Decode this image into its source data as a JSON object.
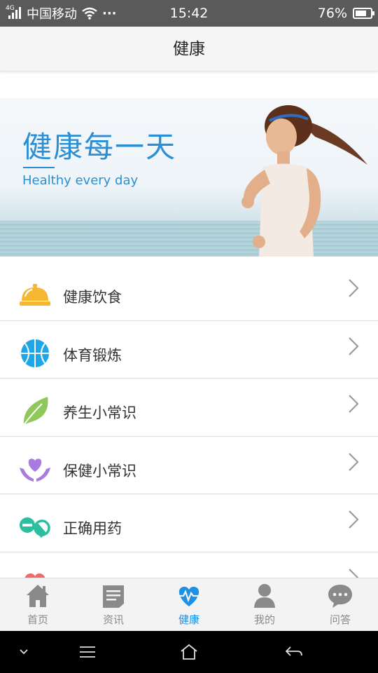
{
  "status_bar": {
    "network": "4G",
    "carrier": "中国移动",
    "more": "···",
    "time": "15:42",
    "battery_text": "76%",
    "battery_level": 0.76
  },
  "header": {
    "title": "健康"
  },
  "banner": {
    "title": "健康每一天",
    "subtitle": "Healthy every day"
  },
  "list": {
    "items": [
      {
        "label": "健康饮食",
        "icon": "food-cloche-icon",
        "color": "#f5b731"
      },
      {
        "label": "体育锻炼",
        "icon": "basketball-icon",
        "color": "#1ea6e8"
      },
      {
        "label": "养生小常识",
        "icon": "leaf-icon",
        "color": "#8fc85a"
      },
      {
        "label": "保健小常识",
        "icon": "heart-hands-icon",
        "color": "#a97ae0"
      },
      {
        "label": "正确用药",
        "icon": "pills-icon",
        "color": "#2bbfa0"
      }
    ]
  },
  "tabbar": {
    "tabs": [
      {
        "label": "首页",
        "icon": "home-icon"
      },
      {
        "label": "资讯",
        "icon": "news-icon"
      },
      {
        "label": "健康",
        "icon": "heartbeat-icon",
        "active": true
      },
      {
        "label": "我的",
        "icon": "user-icon"
      },
      {
        "label": "问答",
        "icon": "chat-icon"
      }
    ],
    "active_color": "#1e90e6",
    "inactive_color": "#8a8a8a"
  },
  "system_nav": {
    "buttons": [
      "chevron-down-icon",
      "menu-icon",
      "home-outline-icon",
      "back-icon"
    ]
  }
}
